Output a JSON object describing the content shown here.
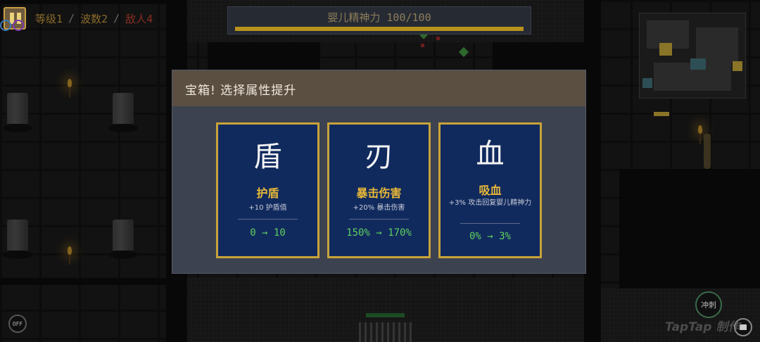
{
  "hud": {
    "level_text": "等级1",
    "wave_text": "波数2",
    "enemy_text": "敌人4",
    "separator": "/"
  },
  "boss": {
    "label": "婴儿精神力 100/100",
    "fill_fraction": 1.0
  },
  "dialog": {
    "title": "宝箱! 选择属性提升",
    "cards": [
      {
        "glyph": "盾",
        "name": "护盾",
        "desc": "+10 护盾值",
        "change": "0 → 10"
      },
      {
        "glyph": "刃",
        "name": "暴击伤害",
        "desc": "+20% 暴击伤害",
        "change": "150% → 170%"
      },
      {
        "glyph": "血",
        "name": "吸血",
        "desc": "+3% 攻击回复婴儿精神力",
        "change": "0% → 3%"
      }
    ]
  },
  "controls": {
    "dash_label": "冲刺",
    "off_label": "OFF"
  },
  "watermark": "TapTap 制作",
  "colors": {
    "card_bg": "#112a5e",
    "card_border": "#c8a33a",
    "stat_name": "#e8b838",
    "change_text": "#5ed05e",
    "boss_fill": "#b8921c"
  },
  "icons": [
    "pause-icon",
    "skill-icon",
    "dash-button",
    "settings-button"
  ]
}
